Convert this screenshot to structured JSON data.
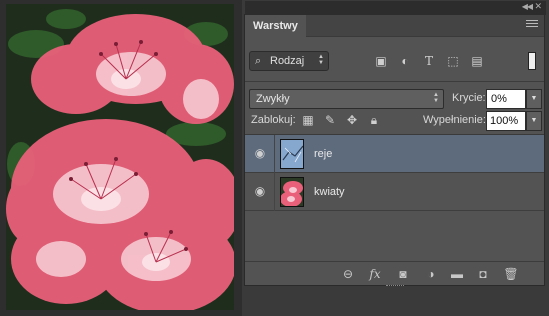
{
  "panel": {
    "tab_label": "Warstwy",
    "filter": {
      "value": "Rodzaj"
    },
    "blend_mode": "Zwykły",
    "opacity": {
      "label": "Krycie:",
      "value": "0%"
    },
    "lock": {
      "label": "Zablokuj:"
    },
    "fill": {
      "label": "Wypełnienie:",
      "value": "100%"
    },
    "layers": [
      {
        "name": "reje",
        "selected": true,
        "visible": true
      },
      {
        "name": "kwiaty",
        "selected": false,
        "visible": true
      }
    ],
    "footer_icons": [
      "link-icon",
      "fx-icon",
      "mask-icon",
      "adjustment-icon",
      "folder-icon",
      "new-layer-icon",
      "trash-icon"
    ]
  },
  "colors": {
    "panel_bg": "#535353",
    "selected_row": "#5e6b7d",
    "photo_pink": "#e8607a"
  }
}
